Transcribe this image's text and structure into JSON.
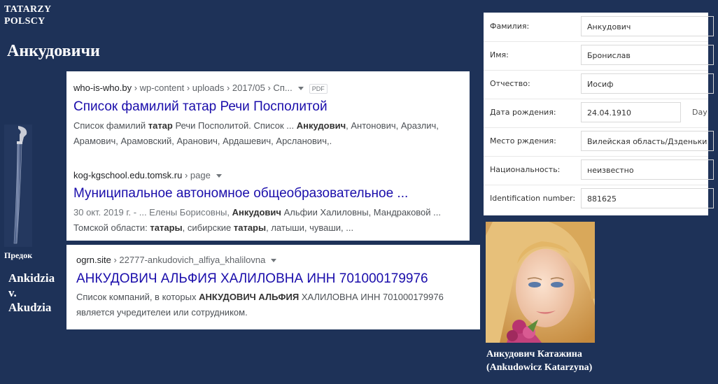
{
  "site": {
    "brand_line1": "TATARZY",
    "brand_line2": "POLSCY",
    "title": "Анкудовичи",
    "ancestor_label": "Предок",
    "ancestor_name_1": "Ankidzia",
    "ancestor_name_2": "v.",
    "ancestor_name_3": "Akudzia"
  },
  "search_results": [
    {
      "domain": "who-is-who.by",
      "path": " › wp-content › uploads › 2017/05 › Сп...",
      "badge": "PDF",
      "title": "Список фамилий татар Речи Посполитой",
      "snippet_1a": "Список фамилий ",
      "snippet_1b": "татар",
      "snippet_1c": " Речи Посполитой. Список ... ",
      "snippet_1d": "Анкудович",
      "snippet_1e": ", Антонович, Аразлич,",
      "snippet_2": "Арамович, Арамовский, Аранович, Ардашевич, Арсланович,."
    },
    {
      "domain": "kog-kgschool.edu.tomsk.ru",
      "path": " › page",
      "title": "Муниципальное автономное общеобразовательное ...",
      "snippet_1a": "30 окт. 2019 г. - ... Елены Борисовны, ",
      "snippet_1b": "Анкудович",
      "snippet_1c": " Альфии Халиловны, Мандраковой ...",
      "snippet_2a": "Томской области: ",
      "snippet_2b": "татары",
      "snippet_2c": ", сибирские ",
      "snippet_2d": "татары",
      "snippet_2e": ", латыши, чуваши, ..."
    },
    {
      "domain": "ogrn.site",
      "path": " › 22777-ankudovich_alfiya_khalilovna",
      "title": "АНКУДОВИЧ АЛЬФИЯ ХАЛИЛОВНА ИНН 701000179976",
      "snippet_1a": "Список компаний, в которых ",
      "snippet_1b": "АНКУДОВИЧ АЛЬФИЯ",
      "snippet_1c": " ХАЛИЛОВНА ИНН 701000179976",
      "snippet_2": "является учредителеи или сотрудником."
    }
  ],
  "form": {
    "rows": [
      {
        "label": "Фамилия:",
        "value": "Анкудович"
      },
      {
        "label": "Имя:",
        "value": "Бронислав"
      },
      {
        "label": "Отчество:",
        "value": "Иосиф"
      },
      {
        "label": "Дата рождения:",
        "value": "24.04.1910",
        "extra": "Day"
      },
      {
        "label": "Место рждения:",
        "value": "Вилейская область/Дзденьки"
      },
      {
        "label": "Национальность:",
        "value": "неизвестно"
      },
      {
        "label": "Identification number:",
        "value": "881625"
      }
    ]
  },
  "photo_caption": {
    "line1": "Анкудович Катажина",
    "line2": "(Ankudowicz Katarzyna)"
  },
  "colors": {
    "background": "#1e3258",
    "link": "#1a0dab"
  }
}
